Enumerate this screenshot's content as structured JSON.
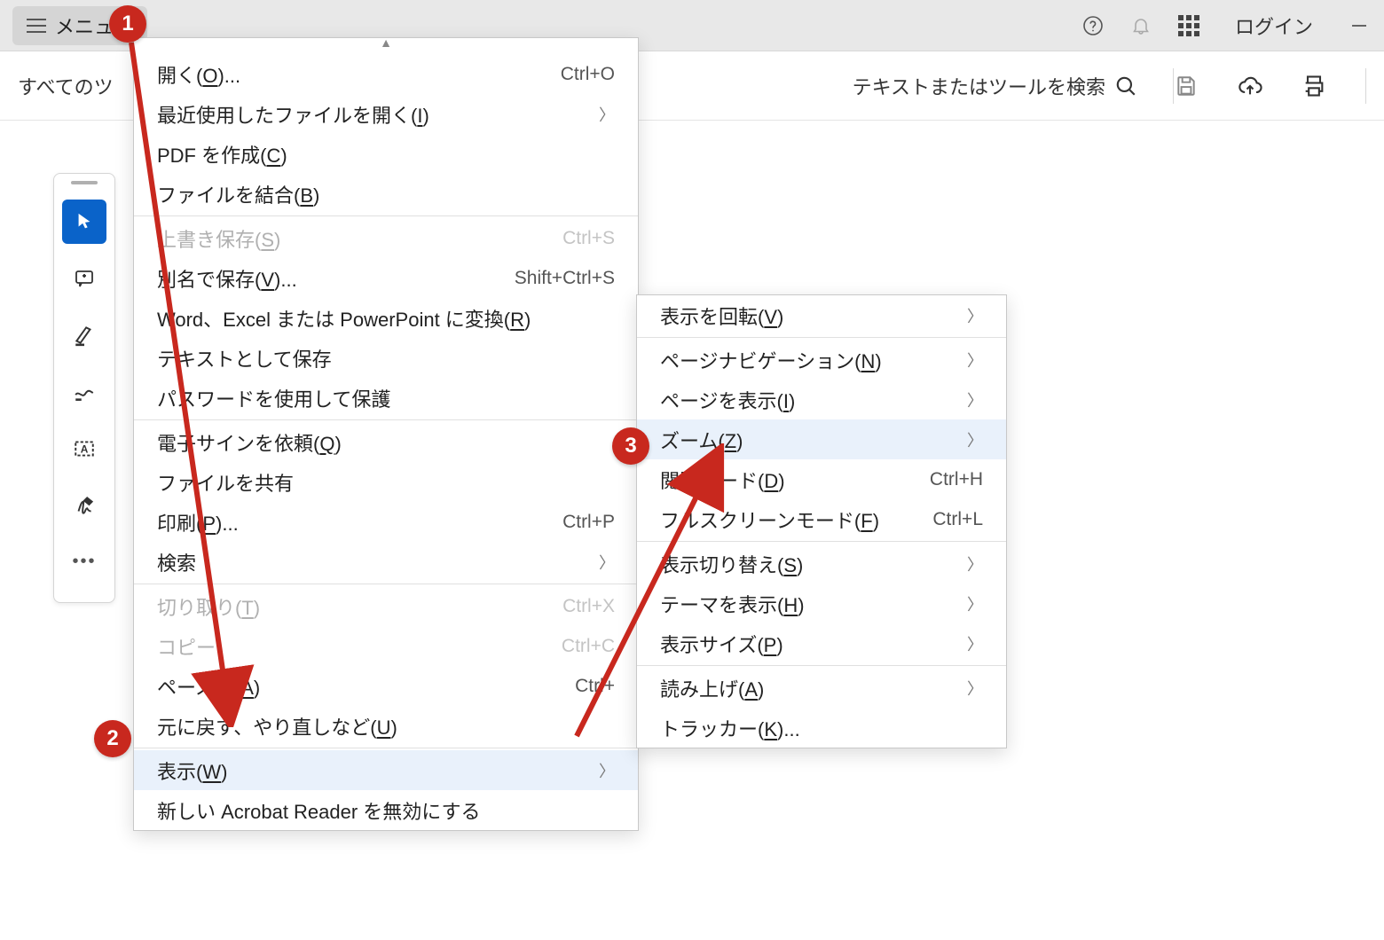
{
  "titlebar": {
    "menu_label": "メニュー",
    "login_label": "ログイン"
  },
  "toolbar": {
    "all_tools_label": "すべてのツ",
    "search_placeholder": "テキストまたはツールを検索"
  },
  "main_menu": {
    "open": {
      "label_pre": "開く(",
      "accel": "O",
      "label_post": ")...",
      "shortcut": "Ctrl+O"
    },
    "recent": {
      "label_pre": "最近使用したファイルを開く(",
      "accel": "I",
      "label_post": ")"
    },
    "create_pdf": {
      "label_pre": "PDF を作成(",
      "accel": "C",
      "label_post": ")"
    },
    "combine": {
      "label_pre": "ファイルを結合(",
      "accel": "B",
      "label_post": ")"
    },
    "save": {
      "label_pre": "上書き保存(",
      "accel": "S",
      "label_post": ")",
      "shortcut": "Ctrl+S"
    },
    "save_as": {
      "label_pre": "別名で保存(",
      "accel": "V",
      "label_post": ")...",
      "shortcut": "Shift+Ctrl+S"
    },
    "convert": {
      "label_pre": "Word、Excel または PowerPoint に変換(",
      "accel": "R",
      "label_post": ")"
    },
    "save_text": {
      "label": "テキストとして保存"
    },
    "protect": {
      "label": "パスワードを使用して保護"
    },
    "esign": {
      "label_pre": "電子サインを依頼(",
      "accel": "Q",
      "label_post": ")"
    },
    "share": {
      "label": "ファイルを共有"
    },
    "print": {
      "label_pre": "印刷(",
      "accel": "P",
      "label_post": ")...",
      "shortcut": "Ctrl+P"
    },
    "find": {
      "label": "検索"
    },
    "cut": {
      "label_pre": "切り取り(",
      "accel": "T",
      "label_post": ")",
      "shortcut": "Ctrl+X"
    },
    "copy": {
      "label": "コピー",
      "shortcut": "Ctrl+C"
    },
    "paste": {
      "label_pre": "ペースト(",
      "accel": "A",
      "label_post": ")",
      "shortcut": "Ctrl+"
    },
    "undo": {
      "label_pre": "元に戻す、やり直しなど(",
      "accel": "U",
      "label_post": ")"
    },
    "view": {
      "label_pre": "表示(",
      "accel": "W",
      "label_post": ")"
    },
    "disable_new": {
      "label": "新しい Acrobat Reader を無効にする"
    }
  },
  "sub_menu": {
    "rotate": {
      "label_pre": "表示を回転(",
      "accel": "V",
      "label_post": ")"
    },
    "pagenav": {
      "label_pre": "ページナビゲーション(",
      "accel": "N",
      "label_post": ")"
    },
    "page_display": {
      "label_pre": "ページを表示(",
      "accel": "I",
      "label_post": ")"
    },
    "zoom": {
      "label_pre": "ズーム(",
      "accel": "Z",
      "label_post": ")"
    },
    "read_mode": {
      "label_pre": "閲覧モード(",
      "accel": "D",
      "label_post": ")",
      "shortcut": "Ctrl+H"
    },
    "fullscreen": {
      "label_pre": "フルスクリーンモード(",
      "accel": "F",
      "label_post": ")",
      "shortcut": "Ctrl+L"
    },
    "toggle": {
      "label_pre": "表示切り替え(",
      "accel": "S",
      "label_post": ")"
    },
    "theme": {
      "label_pre": "テーマを表示(",
      "accel": "H",
      "label_post": ")"
    },
    "size": {
      "label_pre": "表示サイズ(",
      "accel": "P",
      "label_post": ")"
    },
    "read_aloud": {
      "label_pre": "読み上げ(",
      "accel": "A",
      "label_post": ")"
    },
    "tracker": {
      "label_pre": "トラッカー(",
      "accel": "K",
      "label_post": ")..."
    }
  },
  "annotations": {
    "badge1": "1",
    "badge2": "2",
    "badge3": "3"
  }
}
